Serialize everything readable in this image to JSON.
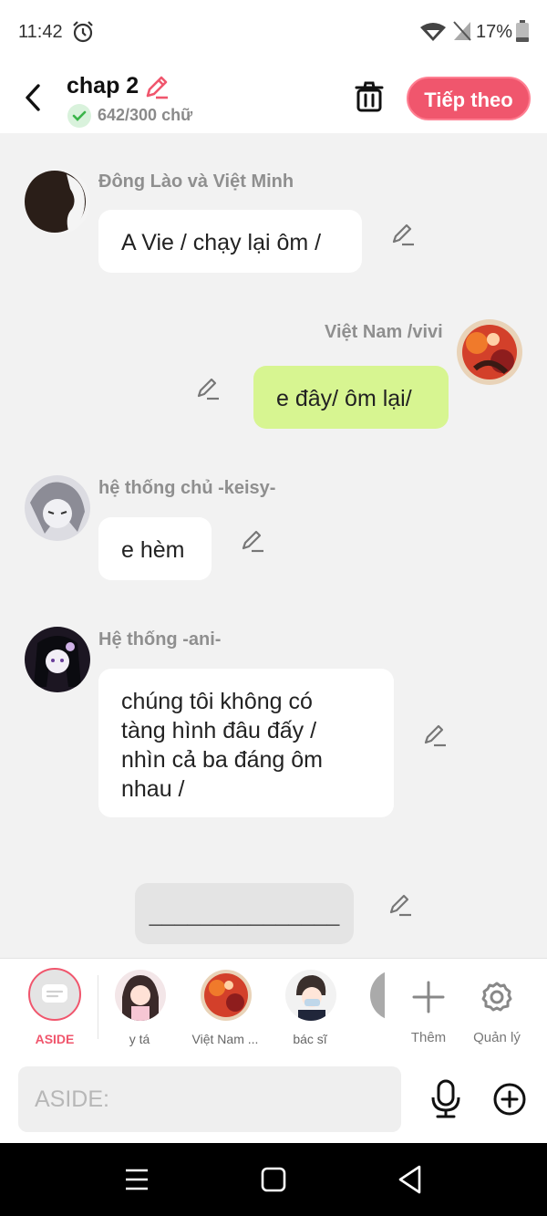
{
  "status": {
    "time": "11:42",
    "battery": "17%"
  },
  "header": {
    "title": "chap 2",
    "count": "642/300 chữ",
    "next_label": "Tiếp theo"
  },
  "messages": [
    {
      "name": "Đông Lào và Việt Minh",
      "text": "A Vie / chạy lại ôm /",
      "side": "left"
    },
    {
      "name": "Việt Nam /vivi",
      "text": "e đây/ ôm lại/",
      "side": "right"
    },
    {
      "name": "hệ thống chủ -keisy-",
      "text": "e hèm",
      "side": "left"
    },
    {
      "name": "Hệ thống -ani-",
      "text_lines": [
        "chúng tôi không có",
        "tàng hình đâu đấy /",
        "nhìn cả ba đáng ôm",
        "nhau /"
      ],
      "side": "left"
    },
    {
      "name": "",
      "text": "_______________",
      "side": "center"
    }
  ],
  "roles": {
    "aside_label": "ASIDE",
    "items": [
      {
        "label": "y tá"
      },
      {
        "label": "Việt Nam ..."
      },
      {
        "label": "bác sĩ"
      }
    ],
    "add_label": "Thêm",
    "manage_label": "Quản lý"
  },
  "input": {
    "placeholder": "ASIDE:"
  },
  "colors": {
    "accent": "#f0566d",
    "green_bubble": "#d7f591",
    "background": "#f2f2f2"
  }
}
